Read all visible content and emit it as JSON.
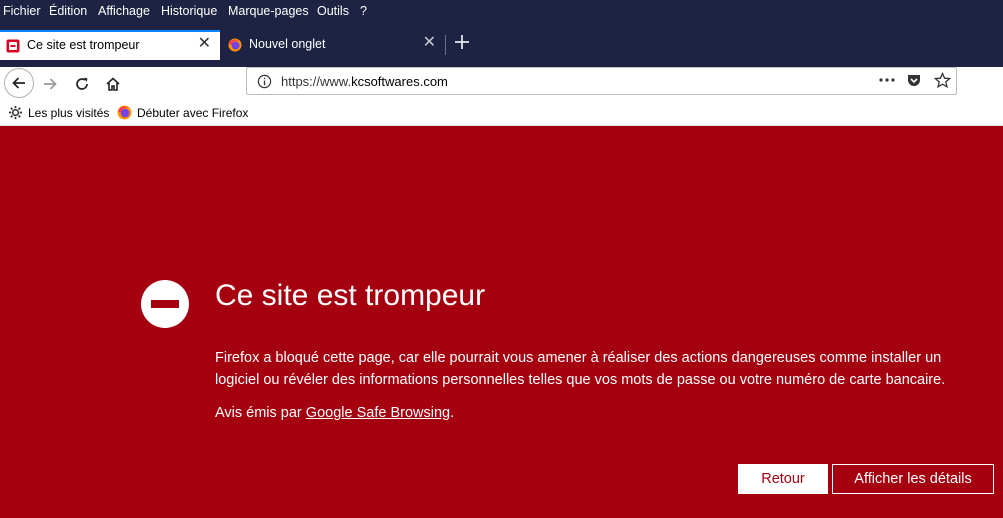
{
  "menu": {
    "items": [
      "Fichier",
      "Édition",
      "Affichage",
      "Historique",
      "Marque-pages",
      "Outils",
      "?"
    ]
  },
  "tabs": [
    {
      "label": "Ce site est trompeur",
      "icon": "blocked-site-icon",
      "active": true
    },
    {
      "label": "Nouvel onglet",
      "icon": "firefox-icon",
      "active": false
    }
  ],
  "new_tab_icon": "plus-icon",
  "urlbar": {
    "prefix": "https://www.",
    "host": "kcsoftwares.com"
  },
  "bookmarks": [
    {
      "label": "Les plus visités",
      "icon": "gear-icon"
    },
    {
      "label": "Débuter avec Firefox",
      "icon": "firefox-icon"
    }
  ],
  "warning": {
    "title": "Ce site est trompeur",
    "body": "Firefox a bloqué cette page, car elle pourrait vous amener à réaliser des actions dangereuses comme installer un logiciel ou révéler des informations personnelles telles que vos mots de passe ou votre numéro de carte bancaire.",
    "source_prefix": "Avis émis par ",
    "source_link": "Google Safe Browsing",
    "source_suffix": ".",
    "back_button": "Retour",
    "details_button": "Afficher les détails"
  },
  "colors": {
    "warning_background": "#a4000f",
    "tabbar_background": "#1f2343",
    "active_tab_accent": "#0a84ff"
  }
}
